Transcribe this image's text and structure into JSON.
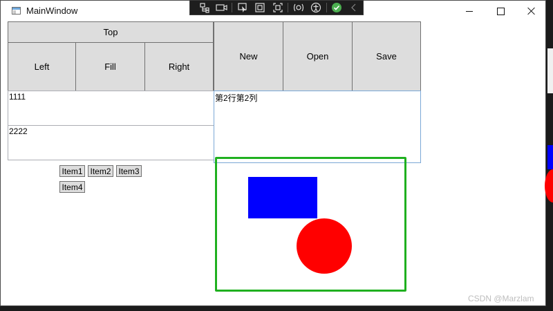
{
  "window": {
    "title": "MainWindow"
  },
  "dock": {
    "top": "Top",
    "left": "Left",
    "fill": "Fill",
    "right": "Right"
  },
  "buttons": {
    "new": "New",
    "open": "Open",
    "save": "Save"
  },
  "textboxes": {
    "row1": "1111",
    "row2": "2222",
    "cell": "第2行第2列"
  },
  "wrap_items": [
    "Item1",
    "Item2",
    "Item3",
    "Item4"
  ],
  "shapes": {
    "frame_color": "#1fb01f",
    "rect_color": "#0000ff",
    "circle_color": "#ff0000"
  },
  "toolbar_icons": [
    "live-visual-tree-icon",
    "record-icon",
    "select-element-icon",
    "display-adorners-icon",
    "track-focus-icon",
    "hot-reload-icon",
    "accessibility-icon",
    "check-icon",
    "collapse-chevron-icon"
  ],
  "watermark": "CSDN @Marzlam"
}
